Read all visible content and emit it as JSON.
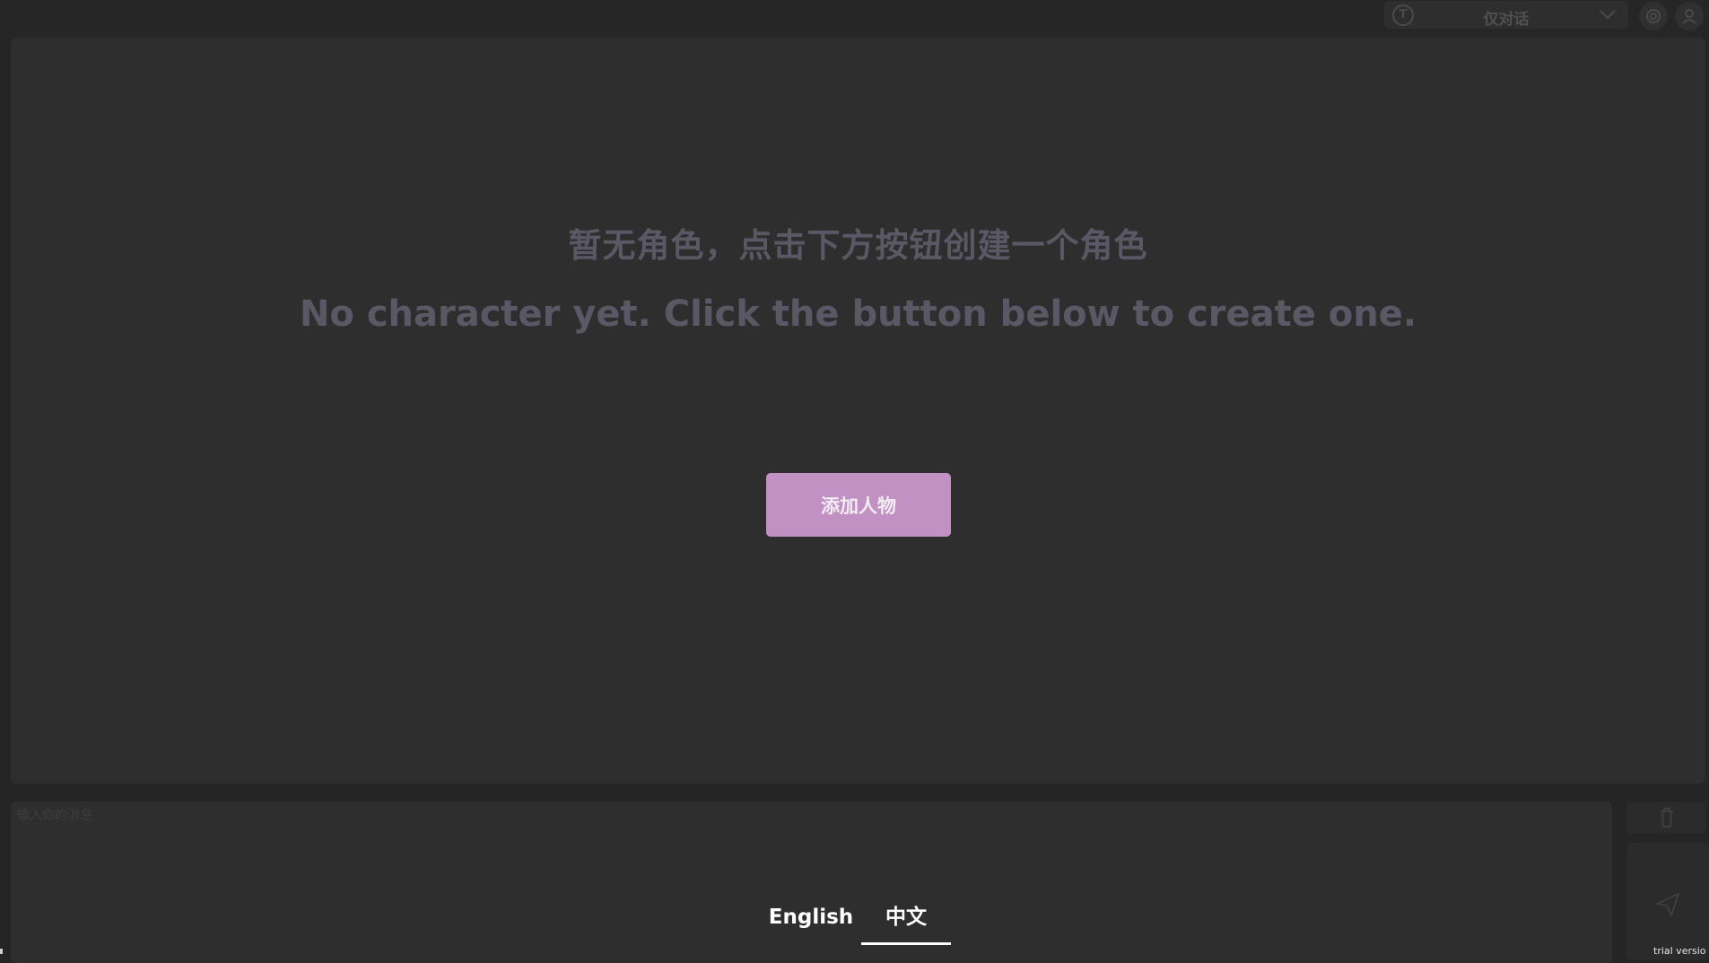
{
  "header": {
    "mode_select": {
      "selected": "仅对话",
      "icon": "t-circle-icon"
    },
    "icons": [
      "settings-icon",
      "user-icon"
    ]
  },
  "main": {
    "empty_message_zh": "暂无角色，点击下方按钮创建一个角色",
    "empty_message_en": "No character yet. Click the button below to create one.",
    "add_button_label": "添加人物"
  },
  "composer": {
    "placeholder": "输入你的消息",
    "trash_icon": "trash-icon",
    "send_icon": "send-icon"
  },
  "language": {
    "tabs": [
      {
        "label": "English",
        "active": false
      },
      {
        "label": "中文",
        "active": true
      }
    ]
  },
  "footer": {
    "trial_label": "trial versio"
  },
  "colors": {
    "background": "#252525",
    "panel": "#2e2e2e",
    "accent": "#c291c4",
    "muted_text": "#5b5866"
  }
}
